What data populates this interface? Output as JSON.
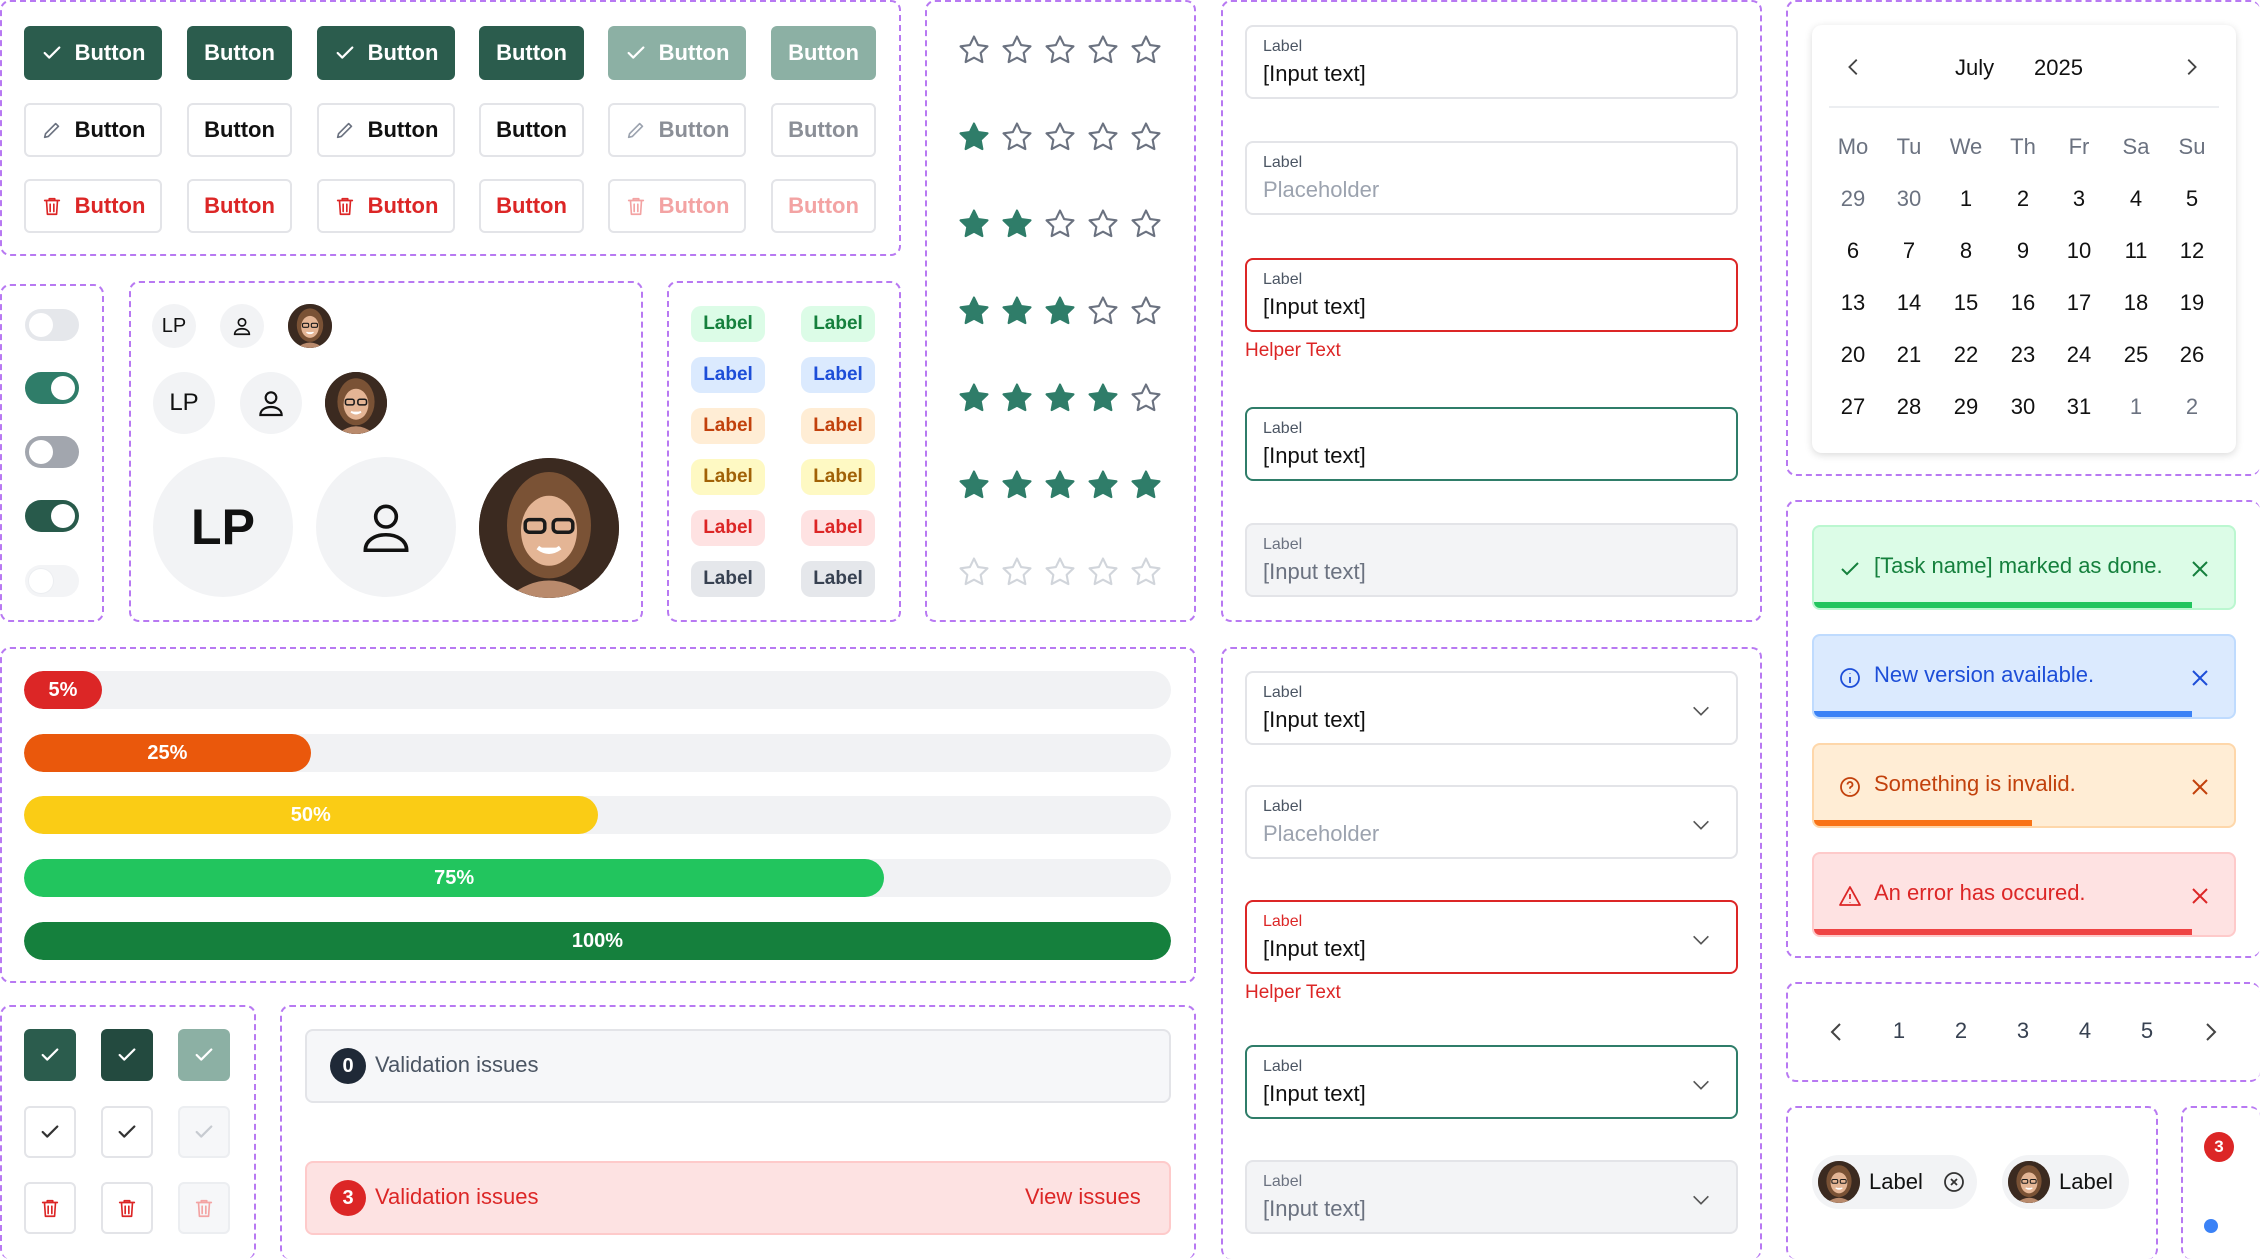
{
  "buttons": {
    "label": "Button"
  },
  "avatars": {
    "initials": "LP"
  },
  "chips": {
    "label": "Label",
    "colors": [
      {
        "bg": "#dcfce7",
        "fg": "#15803d"
      },
      {
        "bg": "#dbeafe",
        "fg": "#1d4ed8"
      },
      {
        "bg": "#ffedd5",
        "fg": "#c2410c"
      },
      {
        "bg": "#fef9c3",
        "fg": "#a16207"
      },
      {
        "bg": "#fee2e2",
        "fg": "#dc2626"
      },
      {
        "bg": "#e5e7eb",
        "fg": "#374151"
      }
    ]
  },
  "ratings": [
    0,
    1,
    2,
    3,
    4,
    5,
    0
  ],
  "text_fields": [
    {
      "label": "Label",
      "value": "[Input text]",
      "state": "default"
    },
    {
      "label": "Label",
      "value": "Placeholder",
      "state": "placeholder"
    },
    {
      "label": "Label",
      "value": "[Input text]",
      "state": "error",
      "helper": "Helper Text"
    },
    {
      "label": "Label",
      "value": "[Input text]",
      "state": "success"
    },
    {
      "label": "Label",
      "value": "[Input text]",
      "state": "disabled"
    }
  ],
  "select_fields": [
    {
      "label": "Label",
      "value": "[Input text]",
      "state": "default"
    },
    {
      "label": "Label",
      "value": "Placeholder",
      "state": "placeholder"
    },
    {
      "label": "Label",
      "value": "[Input text]",
      "state": "error",
      "helper": "Helper Text"
    },
    {
      "label": "Label",
      "value": "[Input text]",
      "state": "success"
    },
    {
      "label": "Label",
      "value": "[Input text]",
      "state": "disabled"
    }
  ],
  "progress": [
    {
      "label": "5%",
      "value": 0.05,
      "color": "#dc2626"
    },
    {
      "label": "25%",
      "value": 0.25,
      "color": "#ea580c"
    },
    {
      "label": "50%",
      "value": 0.5,
      "color": "#facc15"
    },
    {
      "label": "75%",
      "value": 0.75,
      "color": "#22c55e"
    },
    {
      "label": "100%",
      "value": 1.0,
      "color": "#15803d"
    }
  ],
  "calendar": {
    "month": "July",
    "year": "2025",
    "weekdays": [
      "Mo",
      "Tu",
      "We",
      "Th",
      "Fr",
      "Sa",
      "Su"
    ],
    "weeks": [
      [
        "29",
        "30",
        "1",
        "2",
        "3",
        "4",
        "5"
      ],
      [
        "6",
        "7",
        "8",
        "9",
        "10",
        "11",
        "12"
      ],
      [
        "13",
        "14",
        "15",
        "16",
        "17",
        "18",
        "19"
      ],
      [
        "20",
        "21",
        "22",
        "23",
        "24",
        "25",
        "26"
      ],
      [
        "27",
        "28",
        "29",
        "30",
        "31",
        "1",
        "2"
      ]
    ],
    "outside_days": [
      [
        0,
        0
      ],
      [
        0,
        1
      ],
      [
        4,
        5
      ],
      [
        4,
        6
      ]
    ]
  },
  "toasts": [
    {
      "message": "[Task name] marked as done.",
      "kind": "success",
      "bg": "#dcfce7",
      "border": "#bbf7d0",
      "fg": "#15803d",
      "bar": "#22c55e",
      "progress": 0.9
    },
    {
      "message": "New version available.",
      "kind": "info",
      "bg": "#dbeafe",
      "border": "#bfdbfe",
      "fg": "#1d4ed8",
      "bar": "#3b82f6",
      "progress": 0.9
    },
    {
      "message": "Something is invalid.",
      "kind": "warning",
      "bg": "#ffedd5",
      "border": "#fed7aa",
      "fg": "#c2410c",
      "bar": "#f97316",
      "progress": 0.52
    },
    {
      "message": "An error has occured.",
      "kind": "error",
      "bg": "#fee2e2",
      "border": "#fecaca",
      "fg": "#dc2626",
      "bar": "#ef4444",
      "progress": 0.9
    }
  ],
  "pagination": {
    "pages": [
      "1",
      "2",
      "3",
      "4",
      "5"
    ]
  },
  "validation": [
    {
      "count": "0",
      "text": "Validation issues",
      "kind": "neutral"
    },
    {
      "count": "3",
      "text": "Validation issues",
      "kind": "error",
      "action": "View issues"
    }
  ],
  "user_chips": [
    {
      "label": "Label",
      "removable": true
    },
    {
      "label": "Label",
      "removable": false
    }
  ],
  "badge": {
    "count": "3"
  },
  "colors": {
    "primary": "#2b5c4d",
    "accent": "#2f7d69",
    "danger": "#dc2626",
    "border": "#e3e4e8"
  }
}
